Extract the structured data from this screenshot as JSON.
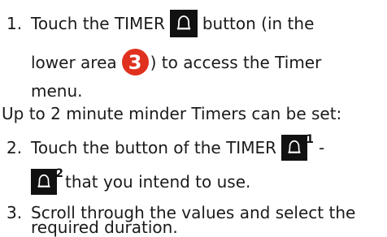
{
  "steps": [
    {
      "num": "1.",
      "text_a": "Touch the TIMER",
      "text_b": "button (in the",
      "text_c": "lower area",
      "marker": "3",
      "text_d": ") to access the Timer",
      "text_e": "menu."
    },
    {
      "num": "2.",
      "text_a": "Touch the button of the TIMER",
      "sup_a": "1",
      "text_b": "-",
      "sup_b": "2",
      "text_c": "that you intend to use."
    },
    {
      "num": "3.",
      "text_a": "Scroll through the values and select the",
      "text_b": "required duration."
    }
  ],
  "note": "Up to 2 minute minder Timers can be set:",
  "icons": {
    "timer": "bell-icon"
  },
  "colors": {
    "marker": "#e0301e",
    "icon_bg": "#111111"
  }
}
